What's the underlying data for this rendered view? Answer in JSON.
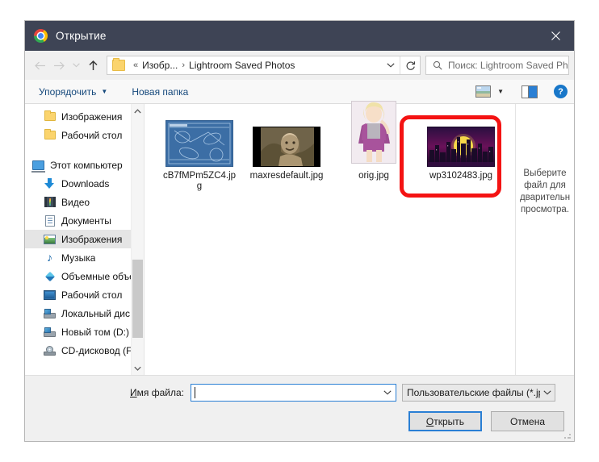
{
  "window": {
    "title": "Открытие",
    "app_icon": "chrome-icon",
    "close_label": "✕",
    "titlebar_color": "#3e4455"
  },
  "navigation": {
    "back_icon": "arrow-left-icon",
    "forward_icon": "arrow-right-icon",
    "history_icon": "chevron-down-icon",
    "up_icon": "arrow-up-icon",
    "breadcrumb": {
      "folder_icon": "folder-icon",
      "overflow": "«",
      "parent": "Изобр...",
      "separator": "›",
      "current": "Lightroom Saved Photos",
      "dropdown_icon": "chevron-down-icon",
      "refresh_icon": "refresh-icon"
    },
    "search": {
      "icon": "search-icon",
      "placeholder": "Поиск: Lightroom Saved Ph..."
    }
  },
  "toolbar": {
    "organize_label": "Упорядочить",
    "organize_caret": "▼",
    "new_folder_label": "Новая папка",
    "view_icon": "view-thumbnails-icon",
    "view_caret": "▼",
    "preview_pane_icon": "preview-pane-icon",
    "help_icon": "help-icon",
    "help_glyph": "?"
  },
  "sidebar": {
    "items": [
      {
        "label": "Изображения",
        "icon": "folder-icon",
        "indent": true,
        "selected": false
      },
      {
        "label": "Рабочий стол",
        "icon": "folder-icon",
        "indent": true,
        "selected": false
      },
      {
        "label": "",
        "icon": "spacer",
        "indent": false,
        "selected": false
      },
      {
        "label": "Этот компьютер",
        "icon": "this-pc-icon",
        "indent": false,
        "selected": false
      },
      {
        "label": "Downloads",
        "icon": "downloads-icon",
        "indent": true,
        "selected": false
      },
      {
        "label": "Видео",
        "icon": "video-icon",
        "indent": true,
        "selected": false
      },
      {
        "label": "Документы",
        "icon": "documents-icon",
        "indent": true,
        "selected": false
      },
      {
        "label": "Изображения",
        "icon": "pictures-icon",
        "indent": true,
        "selected": true
      },
      {
        "label": "Музыка",
        "icon": "music-icon",
        "indent": true,
        "selected": false
      },
      {
        "label": "Объемные объе",
        "icon": "3d-objects-icon",
        "indent": true,
        "selected": false
      },
      {
        "label": "Рабочий стол",
        "icon": "desktop-icon",
        "indent": true,
        "selected": false
      },
      {
        "label": "Локальный дис",
        "icon": "drive-icon",
        "indent": true,
        "selected": false
      },
      {
        "label": "Новый том (D:)",
        "icon": "drive-icon",
        "indent": true,
        "selected": false
      },
      {
        "label": "CD-дисковод (F",
        "icon": "cd-drive-icon",
        "indent": true,
        "selected": false
      }
    ],
    "scrollbar": {
      "up_glyph": "⌃",
      "down_glyph": "⌄"
    }
  },
  "files": [
    {
      "name": "cB7fMPm5ZC4.jpg",
      "thumb": "blueprint",
      "selected": false
    },
    {
      "name": "maxresdefault.jpg",
      "thumb": "sepia",
      "selected": false
    },
    {
      "name": "orig.jpg",
      "thumb": "girl",
      "selected": false
    },
    {
      "name": "wp3102483.jpg",
      "thumb": "city",
      "selected": true
    }
  ],
  "highlight": {
    "color": "#f41313"
  },
  "preview": {
    "lines": [
      "Выберите",
      "файл для",
      "дварительн",
      "просмотра."
    ]
  },
  "footer": {
    "filename_label_prefix": "И",
    "filename_label_rest": "мя файла:",
    "filename_value": "",
    "filename_caret_icon": "chevron-down-icon",
    "filter_value": "Пользовательские файлы (*.jp",
    "filter_caret_icon": "chevron-down-icon",
    "open_button_prefix": "О",
    "open_button_rest": "ткрыть",
    "cancel_button": "Отмена"
  }
}
